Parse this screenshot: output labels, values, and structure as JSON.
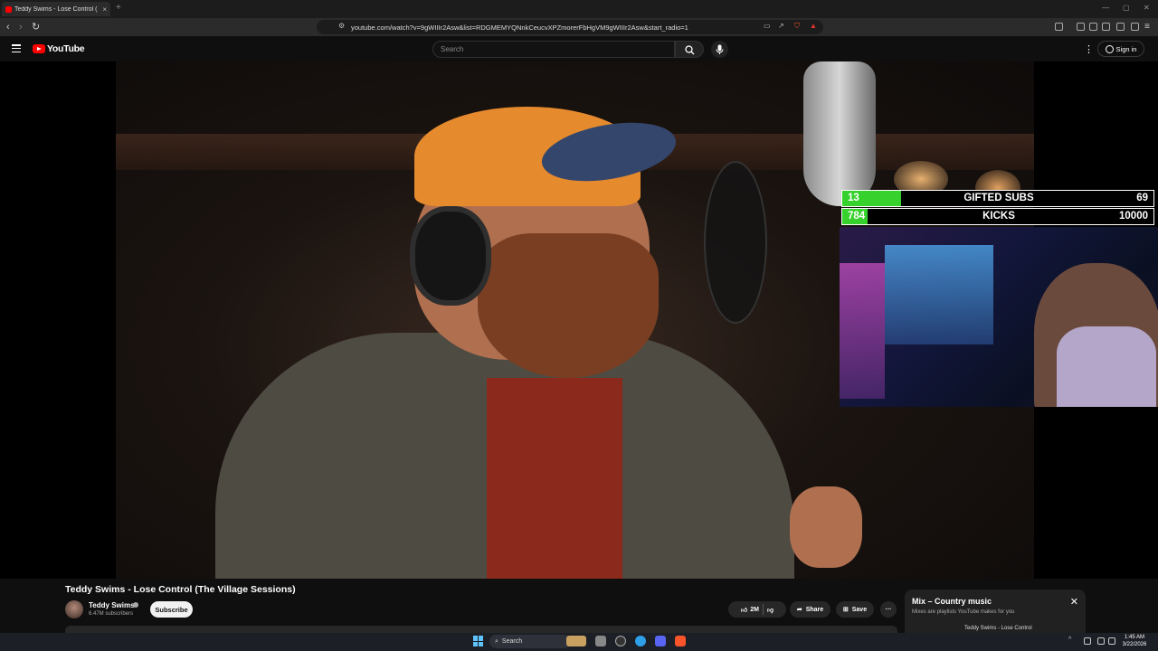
{
  "browser": {
    "tab_title": "Teddy Swims - Lose Control (",
    "tab_close": "×",
    "new_tab": "+",
    "url": "youtube.com/watch?v=9gWIIIr2Asw&list=RDGMEMYQNnkCeucvXPZmorerFbHgVM9gWIIIr2Asw&start_radio=1"
  },
  "youtube": {
    "logo_text": "YouTube",
    "search_placeholder": "Search",
    "sign_in": "Sign in",
    "more": "⋮"
  },
  "overlay": {
    "rows": [
      {
        "current": "13",
        "label": "GIFTED SUBS",
        "goal": "69",
        "progress": 0.19
      },
      {
        "current": "784",
        "label": "KICKS",
        "goal": "10000",
        "progress": 0.08
      }
    ]
  },
  "video_info": {
    "title": "Teddy Swims - Lose Control (The Village Sessions)",
    "channel": "Teddy Swims",
    "subscribers": "6.47M subscribers",
    "subscribe": "Subscribe",
    "likes": "2M",
    "share": "Share",
    "save": "Save",
    "more": "···"
  },
  "mix": {
    "title": "Mix – Country music",
    "subtitle": "Mixes are playlists YouTube makes for you",
    "close": "✕",
    "first_item": "Teddy Swims - Lose Control"
  },
  "taskbar": {
    "search": "Search",
    "time": "1:45 AM",
    "date": "3/22/2026"
  },
  "colors": {
    "yt_red": "#ff0000",
    "progress_green": "#36d12c"
  }
}
